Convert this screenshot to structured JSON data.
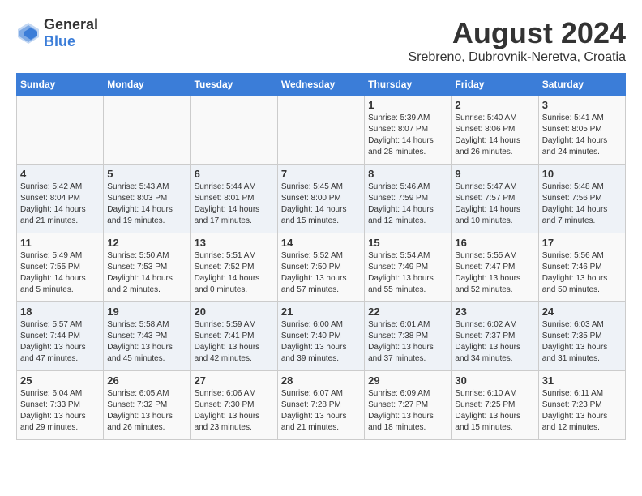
{
  "header": {
    "logo_general": "General",
    "logo_blue": "Blue",
    "month_year": "August 2024",
    "location": "Srebreno, Dubrovnik-Neretva, Croatia"
  },
  "days_of_week": [
    "Sunday",
    "Monday",
    "Tuesday",
    "Wednesday",
    "Thursday",
    "Friday",
    "Saturday"
  ],
  "weeks": [
    [
      {
        "day": "",
        "info": ""
      },
      {
        "day": "",
        "info": ""
      },
      {
        "day": "",
        "info": ""
      },
      {
        "day": "",
        "info": ""
      },
      {
        "day": "1",
        "info": "Sunrise: 5:39 AM\nSunset: 8:07 PM\nDaylight: 14 hours\nand 28 minutes."
      },
      {
        "day": "2",
        "info": "Sunrise: 5:40 AM\nSunset: 8:06 PM\nDaylight: 14 hours\nand 26 minutes."
      },
      {
        "day": "3",
        "info": "Sunrise: 5:41 AM\nSunset: 8:05 PM\nDaylight: 14 hours\nand 24 minutes."
      }
    ],
    [
      {
        "day": "4",
        "info": "Sunrise: 5:42 AM\nSunset: 8:04 PM\nDaylight: 14 hours\nand 21 minutes."
      },
      {
        "day": "5",
        "info": "Sunrise: 5:43 AM\nSunset: 8:03 PM\nDaylight: 14 hours\nand 19 minutes."
      },
      {
        "day": "6",
        "info": "Sunrise: 5:44 AM\nSunset: 8:01 PM\nDaylight: 14 hours\nand 17 minutes."
      },
      {
        "day": "7",
        "info": "Sunrise: 5:45 AM\nSunset: 8:00 PM\nDaylight: 14 hours\nand 15 minutes."
      },
      {
        "day": "8",
        "info": "Sunrise: 5:46 AM\nSunset: 7:59 PM\nDaylight: 14 hours\nand 12 minutes."
      },
      {
        "day": "9",
        "info": "Sunrise: 5:47 AM\nSunset: 7:57 PM\nDaylight: 14 hours\nand 10 minutes."
      },
      {
        "day": "10",
        "info": "Sunrise: 5:48 AM\nSunset: 7:56 PM\nDaylight: 14 hours\nand 7 minutes."
      }
    ],
    [
      {
        "day": "11",
        "info": "Sunrise: 5:49 AM\nSunset: 7:55 PM\nDaylight: 14 hours\nand 5 minutes."
      },
      {
        "day": "12",
        "info": "Sunrise: 5:50 AM\nSunset: 7:53 PM\nDaylight: 14 hours\nand 2 minutes."
      },
      {
        "day": "13",
        "info": "Sunrise: 5:51 AM\nSunset: 7:52 PM\nDaylight: 14 hours\nand 0 minutes."
      },
      {
        "day": "14",
        "info": "Sunrise: 5:52 AM\nSunset: 7:50 PM\nDaylight: 13 hours\nand 57 minutes."
      },
      {
        "day": "15",
        "info": "Sunrise: 5:54 AM\nSunset: 7:49 PM\nDaylight: 13 hours\nand 55 minutes."
      },
      {
        "day": "16",
        "info": "Sunrise: 5:55 AM\nSunset: 7:47 PM\nDaylight: 13 hours\nand 52 minutes."
      },
      {
        "day": "17",
        "info": "Sunrise: 5:56 AM\nSunset: 7:46 PM\nDaylight: 13 hours\nand 50 minutes."
      }
    ],
    [
      {
        "day": "18",
        "info": "Sunrise: 5:57 AM\nSunset: 7:44 PM\nDaylight: 13 hours\nand 47 minutes."
      },
      {
        "day": "19",
        "info": "Sunrise: 5:58 AM\nSunset: 7:43 PM\nDaylight: 13 hours\nand 45 minutes."
      },
      {
        "day": "20",
        "info": "Sunrise: 5:59 AM\nSunset: 7:41 PM\nDaylight: 13 hours\nand 42 minutes."
      },
      {
        "day": "21",
        "info": "Sunrise: 6:00 AM\nSunset: 7:40 PM\nDaylight: 13 hours\nand 39 minutes."
      },
      {
        "day": "22",
        "info": "Sunrise: 6:01 AM\nSunset: 7:38 PM\nDaylight: 13 hours\nand 37 minutes."
      },
      {
        "day": "23",
        "info": "Sunrise: 6:02 AM\nSunset: 7:37 PM\nDaylight: 13 hours\nand 34 minutes."
      },
      {
        "day": "24",
        "info": "Sunrise: 6:03 AM\nSunset: 7:35 PM\nDaylight: 13 hours\nand 31 minutes."
      }
    ],
    [
      {
        "day": "25",
        "info": "Sunrise: 6:04 AM\nSunset: 7:33 PM\nDaylight: 13 hours\nand 29 minutes."
      },
      {
        "day": "26",
        "info": "Sunrise: 6:05 AM\nSunset: 7:32 PM\nDaylight: 13 hours\nand 26 minutes."
      },
      {
        "day": "27",
        "info": "Sunrise: 6:06 AM\nSunset: 7:30 PM\nDaylight: 13 hours\nand 23 minutes."
      },
      {
        "day": "28",
        "info": "Sunrise: 6:07 AM\nSunset: 7:28 PM\nDaylight: 13 hours\nand 21 minutes."
      },
      {
        "day": "29",
        "info": "Sunrise: 6:09 AM\nSunset: 7:27 PM\nDaylight: 13 hours\nand 18 minutes."
      },
      {
        "day": "30",
        "info": "Sunrise: 6:10 AM\nSunset: 7:25 PM\nDaylight: 13 hours\nand 15 minutes."
      },
      {
        "day": "31",
        "info": "Sunrise: 6:11 AM\nSunset: 7:23 PM\nDaylight: 13 hours\nand 12 minutes."
      }
    ]
  ]
}
